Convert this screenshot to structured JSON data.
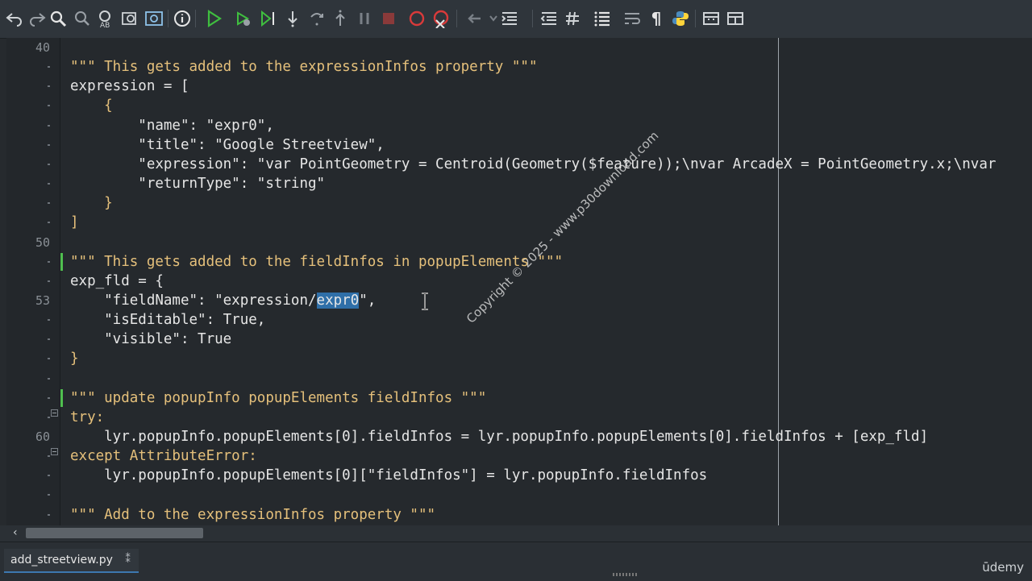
{
  "toolbar": {
    "buttons": [
      {
        "name": "undo-icon"
      },
      {
        "name": "redo-icon"
      },
      {
        "name": "search-icon"
      },
      {
        "name": "find-replace-icon"
      },
      {
        "name": "find-abc-icon"
      },
      {
        "name": "find-in-files-icon"
      },
      {
        "name": "find-results-icon"
      },
      {
        "name": "info-icon"
      },
      {
        "name": "run-icon"
      },
      {
        "name": "debug-icon"
      },
      {
        "name": "run-to-cursor-icon"
      },
      {
        "name": "step-into-icon"
      },
      {
        "name": "step-over-icon"
      },
      {
        "name": "step-out-icon"
      },
      {
        "name": "pause-icon"
      },
      {
        "name": "stop-icon"
      },
      {
        "name": "breakpoint-icon"
      },
      {
        "name": "clear-breakpoints-icon"
      },
      {
        "name": "back-icon"
      },
      {
        "name": "forward-icon"
      },
      {
        "name": "indent-icon"
      },
      {
        "name": "outdent-icon"
      },
      {
        "name": "comment-icon"
      },
      {
        "name": "list-icon"
      },
      {
        "name": "wrap-icon"
      },
      {
        "name": "pilcrow-icon"
      },
      {
        "name": "python-icon"
      },
      {
        "name": "toolbox-icon"
      },
      {
        "name": "layout-icon"
      }
    ],
    "pilcrow": "¶"
  },
  "editor": {
    "line_numbers": [
      {
        "label": "40",
        "row": 0
      },
      {
        "label": "50",
        "row": 10
      },
      {
        "label": "53",
        "row": 13
      },
      {
        "label": "60",
        "row": 20
      }
    ],
    "lines": [
      {
        "row": 0,
        "parts": []
      },
      {
        "row": 1,
        "parts": [
          {
            "t": "\"\"\" This gets added to the expressionInfos property \"\"\"",
            "c": "cm"
          }
        ]
      },
      {
        "row": 2,
        "parts": [
          {
            "t": "expression = [",
            "c": "n"
          }
        ]
      },
      {
        "row": 3,
        "parts": [
          {
            "t": "    {",
            "c": "s"
          }
        ]
      },
      {
        "row": 4,
        "parts": [
          {
            "t": "        \"name\": \"expr0\",",
            "c": "n"
          }
        ]
      },
      {
        "row": 5,
        "parts": [
          {
            "t": "        \"title\": \"Google Streetview\",",
            "c": "n"
          }
        ]
      },
      {
        "row": 6,
        "parts": [
          {
            "t": "        \"expression\": \"var PointGeometry = Centroid(Geometry($feature));\\nvar ArcadeX = PointGeometry.x;\\nvar",
            "c": "n"
          }
        ]
      },
      {
        "row": 7,
        "parts": [
          {
            "t": "        \"returnType\": \"string\"",
            "c": "n"
          }
        ]
      },
      {
        "row": 8,
        "parts": [
          {
            "t": "    }",
            "c": "s"
          }
        ]
      },
      {
        "row": 9,
        "parts": [
          {
            "t": "]",
            "c": "s"
          }
        ]
      },
      {
        "row": 10,
        "parts": []
      },
      {
        "row": 11,
        "parts": [
          {
            "t": "\"\"\" This gets added to the fieldInfos in popupElements \"\"\"",
            "c": "cm"
          }
        ]
      },
      {
        "row": 12,
        "parts": [
          {
            "t": "exp_fld = {",
            "c": "n"
          }
        ]
      },
      {
        "row": 13,
        "parts": [
          {
            "t": "    \"fieldName\": \"expression/",
            "c": "n"
          },
          {
            "t": "expr0",
            "c": "hl"
          },
          {
            "t": "\",",
            "c": "n"
          }
        ]
      },
      {
        "row": 14,
        "parts": [
          {
            "t": "    \"isEditable\": True,",
            "c": "n"
          }
        ]
      },
      {
        "row": 15,
        "parts": [
          {
            "t": "    \"visible\": True",
            "c": "n"
          }
        ]
      },
      {
        "row": 16,
        "parts": [
          {
            "t": "}",
            "c": "s"
          }
        ]
      },
      {
        "row": 17,
        "parts": []
      },
      {
        "row": 18,
        "parts": [
          {
            "t": "\"\"\" update popupInfo popupElements fieldInfos \"\"\"",
            "c": "cm"
          }
        ]
      },
      {
        "row": 19,
        "parts": [
          {
            "t": "try:",
            "c": "s"
          }
        ]
      },
      {
        "row": 20,
        "parts": [
          {
            "t": "    lyr.popupInfo.popupElements[0].fieldInfos = lyr.popupInfo.popupElements[0].fieldInfos + [exp_fld]",
            "c": "n"
          }
        ]
      },
      {
        "row": 21,
        "parts": [
          {
            "t": "except AttributeError:",
            "c": "s"
          }
        ]
      },
      {
        "row": 22,
        "parts": [
          {
            "t": "    lyr.popupInfo.popupElements[0][\"fieldInfos\"] = lyr.popupInfo.fieldInfos",
            "c": "n"
          }
        ]
      },
      {
        "row": 23,
        "parts": []
      },
      {
        "row": 24,
        "parts": [
          {
            "t": "\"\"\" Add to the expressionInfos property \"\"\"",
            "c": "cm"
          }
        ]
      }
    ],
    "fold_rows": [
      19,
      21
    ],
    "change_rows": [
      11,
      18
    ],
    "watermark": "Copyright © 2025 - www.p30download.com"
  },
  "tab": {
    "filename": "add_streetview.py",
    "close": "⁑"
  },
  "brand": "ūdemy",
  "colors": {
    "accent": "#3d78b0",
    "run_green": "#3fbf3f",
    "stop_red": "#d93a3a"
  }
}
